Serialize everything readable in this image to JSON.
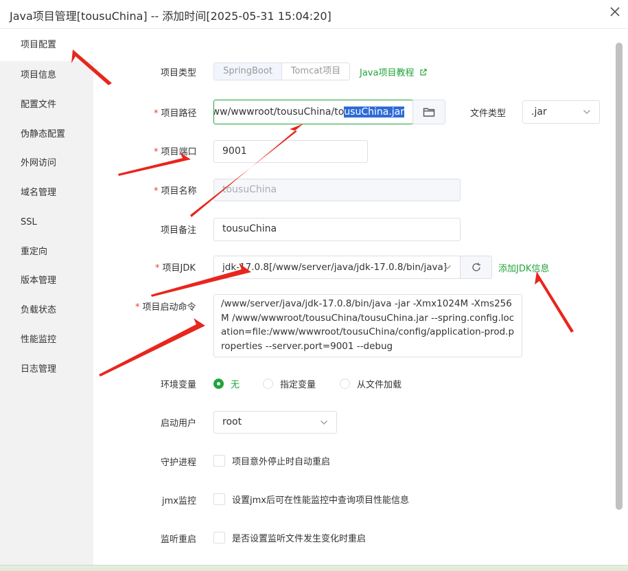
{
  "window": {
    "title": "Java项目管理[tousuChina] -- 添加时间[2025-05-31 15:04:20]"
  },
  "sidebar": {
    "items": [
      {
        "label": "项目配置"
      },
      {
        "label": "项目信息"
      },
      {
        "label": "配置文件"
      },
      {
        "label": "伪静态配置"
      },
      {
        "label": "外网访问"
      },
      {
        "label": "域名管理"
      },
      {
        "label": "SSL"
      },
      {
        "label": "重定向"
      },
      {
        "label": "版本管理"
      },
      {
        "label": "负载状态"
      },
      {
        "label": "性能监控"
      },
      {
        "label": "日志管理"
      }
    ]
  },
  "form": {
    "project_type": {
      "label": "项目类型",
      "options": [
        "SpringBoot",
        "Tomcat项目"
      ],
      "selected": "SpringBoot",
      "tutorial_link": "Java项目教程"
    },
    "project_path": {
      "required": "*",
      "label": "项目路径",
      "value_prefix": "/www/wwwroot/tousuChina/to",
      "value_selected": "usuChina.jar"
    },
    "file_type": {
      "label": "文件类型",
      "value": ".jar"
    },
    "project_port": {
      "required": "*",
      "label": "项目端口",
      "value": "9001"
    },
    "project_name": {
      "required": "*",
      "label": "项目名称",
      "value": "tousuChina"
    },
    "project_note": {
      "label": "项目备注",
      "value": "tousuChina"
    },
    "project_jdk": {
      "required": "*",
      "label": "项目JDK",
      "value": "jdk-17.0.8[/www/server/java/jdk-17.0.8/bin/java]",
      "add_link": "添加JDK信息"
    },
    "start_command": {
      "required": "*",
      "label": "项目启动命令",
      "value": "/www/server/java/jdk-17.0.8/bin/java -jar  -Xmx1024M -Xms256M /www/wwwroot/tousuChina/tousuChina.jar --spring.config.location=file:/www/wwwroot/tousuChina/config/application-prod.properties --server.port=9001 --debug"
    },
    "env_vars": {
      "label": "环境变量",
      "options": [
        "无",
        "指定变量",
        "从文件加载"
      ],
      "selected": "无"
    },
    "run_user": {
      "label": "启动用户",
      "value": "root"
    },
    "daemon": {
      "label": "守护进程",
      "text": "项目意外停止时自动重启",
      "checked": false
    },
    "jmx": {
      "label": "jmx监控",
      "text": "设置jmx后可在性能监控中查询项目性能信息",
      "checked": false
    },
    "watch_restart": {
      "label": "监听重启",
      "text": "是否设置监听文件发生变化时重启",
      "checked": false
    }
  },
  "colors": {
    "accent": "#20a53a",
    "required": "#e6413b",
    "annotation_arrow": "#e8261d",
    "sidebar_bg": "#f2f2f2"
  }
}
